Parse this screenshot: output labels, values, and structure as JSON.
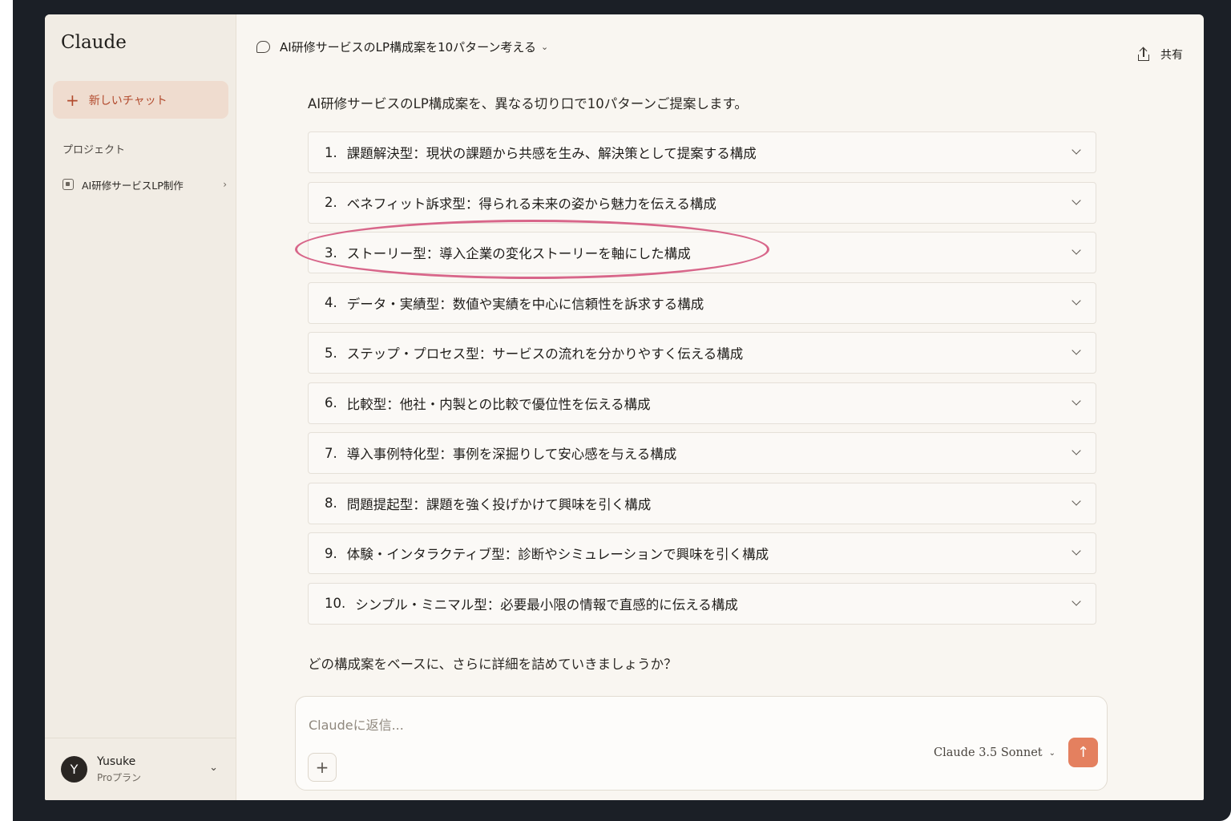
{
  "app": {
    "name": "Claude"
  },
  "sidebar": {
    "new_chat_label": "新しいチャット",
    "projects_label": "プロジェクト",
    "projects": [
      {
        "label": "AI研修サービスLP制作"
      }
    ],
    "user": {
      "initial": "Y",
      "name": "Yusuke",
      "plan": "Proプラン"
    }
  },
  "header": {
    "chat_title": "AI研修サービスのLP構成案を10パターン考える",
    "share_label": "共有"
  },
  "message": {
    "intro": "AI研修サービスのLP構成案を、異なる切り口で10パターンご提案します。",
    "options": [
      {
        "num": "1.",
        "text": "課題解決型：現状の課題から共感を生み、解決策として提案する構成"
      },
      {
        "num": "2.",
        "text": "ベネフィット訴求型：得られる未来の姿から魅力を伝える構成"
      },
      {
        "num": "3.",
        "text": "ストーリー型：導入企業の変化ストーリーを軸にした構成"
      },
      {
        "num": "4.",
        "text": "データ・実績型：数値や実績を中心に信頼性を訴求する構成"
      },
      {
        "num": "5.",
        "text": "ステップ・プロセス型：サービスの流れを分かりやすく伝える構成"
      },
      {
        "num": "6.",
        "text": "比較型：他社・内製との比較で優位性を伝える構成"
      },
      {
        "num": "7.",
        "text": "導入事例特化型：事例を深掘りして安心感を与える構成"
      },
      {
        "num": "8.",
        "text": "問題提起型：課題を強く投げかけて興味を引く構成"
      },
      {
        "num": "9.",
        "text": "体験・インタラクティブ型：診断やシミュレーションで興味を引く構成"
      },
      {
        "num": "10.",
        "text": "シンプル・ミニマル型：必要最小限の情報で直感的に伝える構成"
      }
    ],
    "closing": "どの構成案をベースに、さらに詳細を詰めていきましょうか？"
  },
  "composer": {
    "placeholder": "Claudeに返信...",
    "model": "Claude 3.5 Sonnet"
  },
  "colors": {
    "accent": "#e4805f",
    "highlight_circle": "#d8668a",
    "new_chat_bg": "#efdccf"
  }
}
